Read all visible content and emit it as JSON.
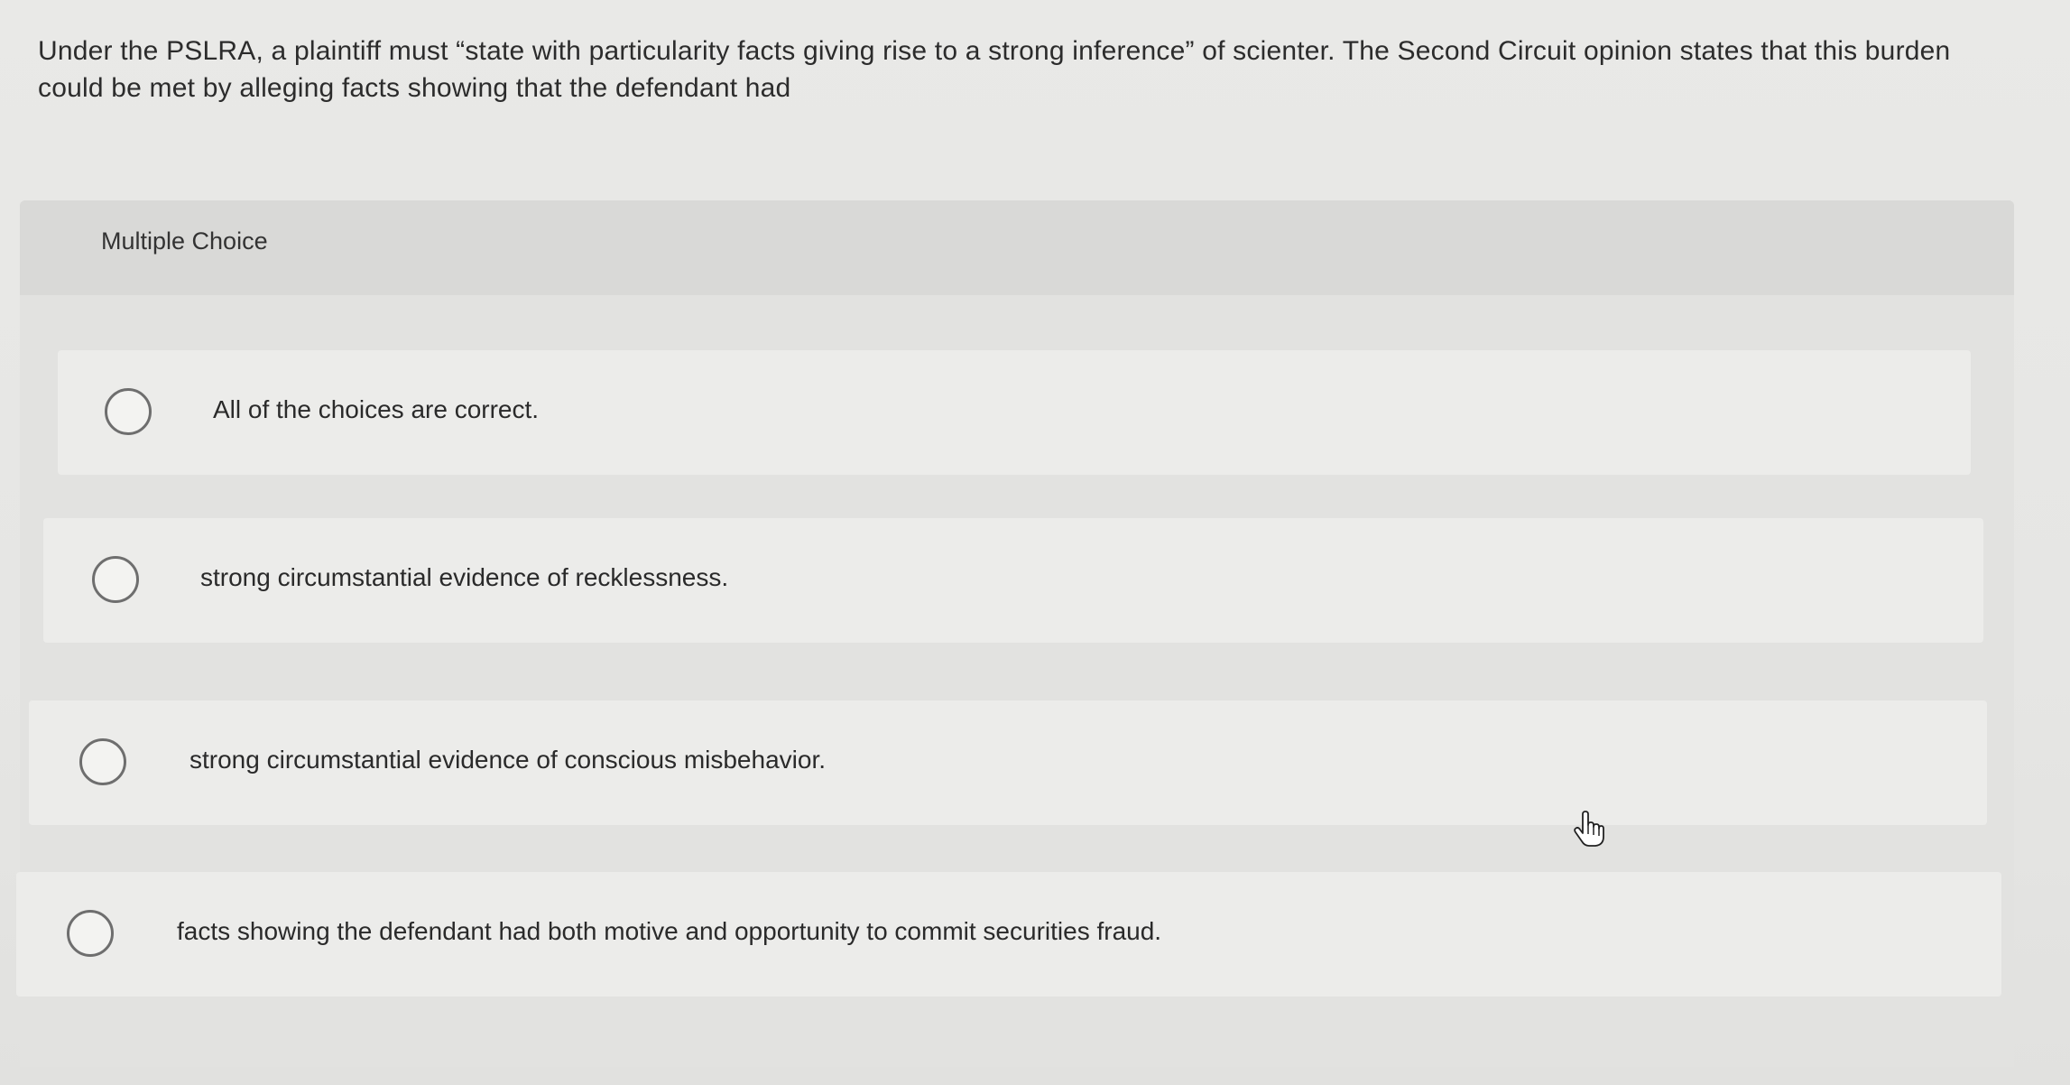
{
  "question": {
    "text": "Under the PSLRA, a plaintiff must “state with particularity facts giving rise to a strong inference” of scienter. The Second Circuit opinion states that this burden could be met by alleging facts showing that the defendant had"
  },
  "panel": {
    "label": "Multiple Choice"
  },
  "choices": [
    {
      "label": "All of the choices are correct."
    },
    {
      "label": "strong circumstantial evidence of recklessness."
    },
    {
      "label": "strong circumstantial evidence of conscious misbehavior."
    },
    {
      "label": "facts showing the defendant had both motive and opportunity to commit securities fraud."
    }
  ],
  "cursor": {
    "icon": "hand-pointer-icon"
  }
}
